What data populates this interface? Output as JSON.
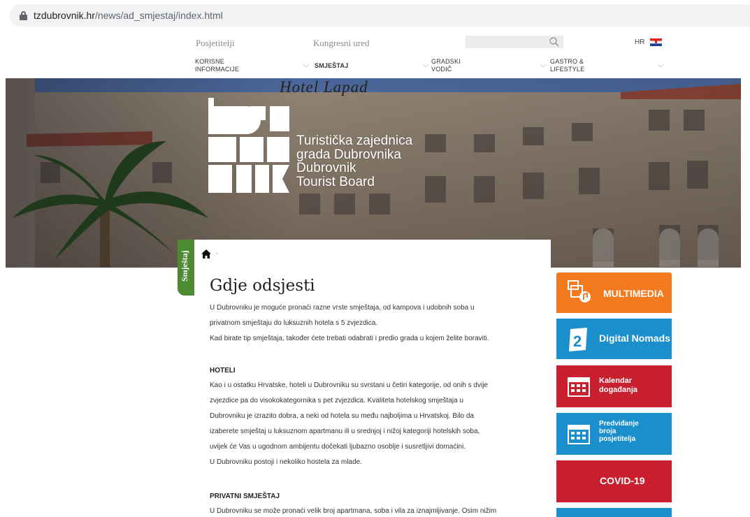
{
  "browser": {
    "url_domain": "tzdubrovnik.hr",
    "url_path": "/news/ad_smjestaj/index.html"
  },
  "topbar": {
    "link_visitors": "Posjetitelji",
    "link_congress": "Kongresni ured",
    "language": "HR"
  },
  "nav": {
    "useful_info_line1": "KORISNE",
    "useful_info_line2": "INFORMACIJE",
    "accommodation": "SMJEŠTAJ",
    "city_guide_line1": "GRADSKI",
    "city_guide_line2": "VODIČ",
    "gastro_line1": "GASTRO &",
    "gastro_line2": "LIFESTYLE"
  },
  "hero": {
    "sign_text": "Hotel Lapad",
    "line1": "Turistička zajednica",
    "line2": "grada Dubrovnika",
    "line3": "Dubrovnik",
    "line4": "Tourist Board"
  },
  "side_tab": {
    "label": "Smještaj"
  },
  "content": {
    "breadcrumb_sep": "›",
    "title": "Gdje odsjesti",
    "intro": [
      "U Dubrovniku je moguće pronaći razne vrste smještaja, od kampova i udobnih soba u",
      "privatnom smještaju do luksuznih hotela s 5 zvjezdica.",
      "Kad birate tip smještaja, također ćete trebati odabrati i predio grada u kojem želite boraviti."
    ],
    "hotels_heading": "HOTELI",
    "hotels": [
      "Kao i u ostatku Hrvatske, hoteli u Dubrovniku su svrstani u četiri kategorije, od onih s dvije",
      "zvjezdice pa do visokokategornika s pet zvjezdica. Kvaliteta hotelskog smještaja u",
      "Dubrovniku je izrazito dobra, a neki od hotela su među najboljima u Hrvatskoj. Bilo da",
      "izaberete smještaj u luksuznom apartmanu ili u srednjoj i nižoj kategoriji hotelskih soba,",
      "uvijek će Vas u ugodnom ambijentu dočekati ljubazno osoblje i susretljivi domaćini.",
      "U Dubrovniku postoji i nekoliko hostela za mlade."
    ],
    "private_heading": "PRIVATNI SMJEŠTAJ",
    "private": [
      "U Dubrovniku se može pronaći velik broj apartmana, soba i vila za iznajmljivanje. Osim nižim"
    ]
  },
  "tiles": {
    "multimedia": "MULTIMEDIA",
    "digital_nomads": "Digital Nomads",
    "calendar_line1": "Kalendar",
    "calendar_line2": "događanja",
    "forecast_line1": "Predviđanje",
    "forecast_line2": "broja",
    "forecast_line3": "posjetitelja",
    "covid": "COVID-19"
  },
  "colors": {
    "orange": "#f47a20",
    "blue": "#1a8fcb",
    "red": "#c8202f",
    "green": "#4c8a33"
  }
}
